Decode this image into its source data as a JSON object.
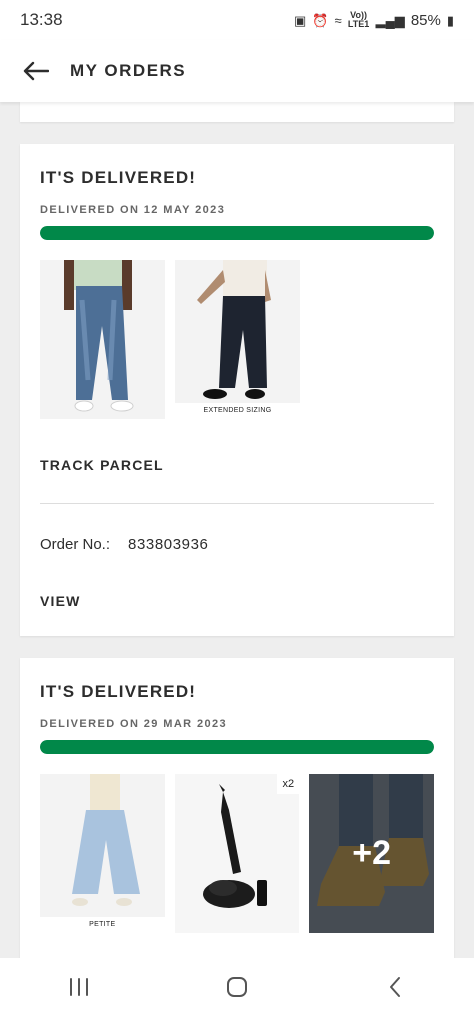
{
  "status_bar": {
    "time": "13:38",
    "network": "Vo)) LTE1",
    "battery": "85%"
  },
  "header": {
    "title": "MY ORDERS",
    "back_icon": "arrow-left-icon"
  },
  "orders": [
    {
      "status": "IT'S DELIVERED!",
      "delivered_date": "DELIVERED ON 12 MAY 2023",
      "progress": 1.0,
      "items": [
        {
          "tag": ""
        },
        {
          "tag": "EXTENDED SIZING"
        }
      ],
      "track_label": "TRACK PARCEL",
      "order_no_label": "Order No.:",
      "order_no": "833803936",
      "view_label": "VIEW"
    },
    {
      "status": "IT'S DELIVERED!",
      "delivered_date": "DELIVERED ON 29 MAR 2023",
      "progress": 1.0,
      "items": [
        {
          "tag": "PETITE"
        },
        {
          "qty": "x2"
        },
        {
          "more": "+2"
        }
      ]
    }
  ],
  "colors": {
    "progress": "#018849",
    "text": "#2d2d2d",
    "background": "#eeeeee"
  },
  "nav": {
    "recent_icon": "recent-apps-icon",
    "home_icon": "home-icon",
    "back_icon": "back-chevron-icon"
  }
}
